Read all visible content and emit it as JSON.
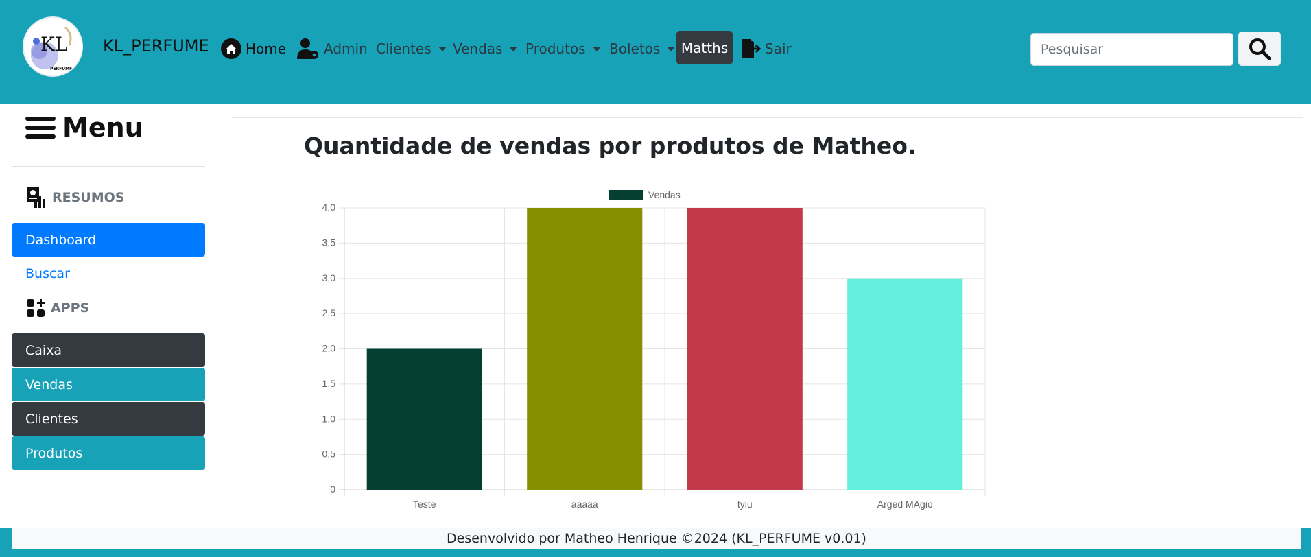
{
  "navbar": {
    "brand": "KL_PERFUME",
    "logo_text": "KL",
    "logo_sub": "PERFUME",
    "items": [
      {
        "label": "Home",
        "icon": "home-icon"
      },
      {
        "label": "Admin",
        "icon": "user-gear-icon"
      },
      {
        "label": "Clientes",
        "dropdown": true
      },
      {
        "label": "Vendas",
        "dropdown": true
      },
      {
        "label": "Produtos",
        "dropdown": true
      },
      {
        "label": "Boletos",
        "dropdown": true
      },
      {
        "label": "Matths"
      },
      {
        "label": "Sair",
        "icon": "door-exit-icon"
      }
    ],
    "search_placeholder": "Pesquisar",
    "bg_color": "#17a2b8"
  },
  "sidebar": {
    "menu_title": "Menu",
    "sections": [
      {
        "heading": "RESUMOS",
        "icon": "report-icon"
      },
      {
        "heading": "APPS",
        "icon": "apps-grid-icon"
      }
    ],
    "items": [
      {
        "label": "Dashboard",
        "color": "#007bff"
      },
      {
        "label": "Buscar",
        "color": "#007bff"
      },
      {
        "label": "Caixa",
        "color": "#343a40"
      },
      {
        "label": "Vendas",
        "color": "#17a2b8"
      },
      {
        "label": "Clientes",
        "color": "#343a40"
      },
      {
        "label": "Produtos",
        "color": "#17a2b8"
      }
    ]
  },
  "main": {
    "title": "Quantidade de vendas por produtos de Matheo."
  },
  "chart_data": {
    "type": "bar",
    "categories": [
      "Teste",
      "aaaaa",
      "tyiu",
      "Arged MAgio"
    ],
    "series": [
      {
        "name": "Vendas",
        "values": [
          2,
          4,
          4,
          3
        ],
        "colors": [
          "#053f31",
          "#868f00",
          "#c3384a",
          "#63efde"
        ]
      }
    ],
    "ylim": [
      0,
      4
    ],
    "yticks": [
      "0",
      "0,5",
      "1,0",
      "1,5",
      "2,0",
      "2,5",
      "3,0",
      "3,5",
      "4,0"
    ],
    "legend_placement": "top-center",
    "grid": true
  },
  "footer": {
    "text": "Desenvolvido por Matheo Henrique ©2024 (KL_PERFUME v0.01)"
  }
}
